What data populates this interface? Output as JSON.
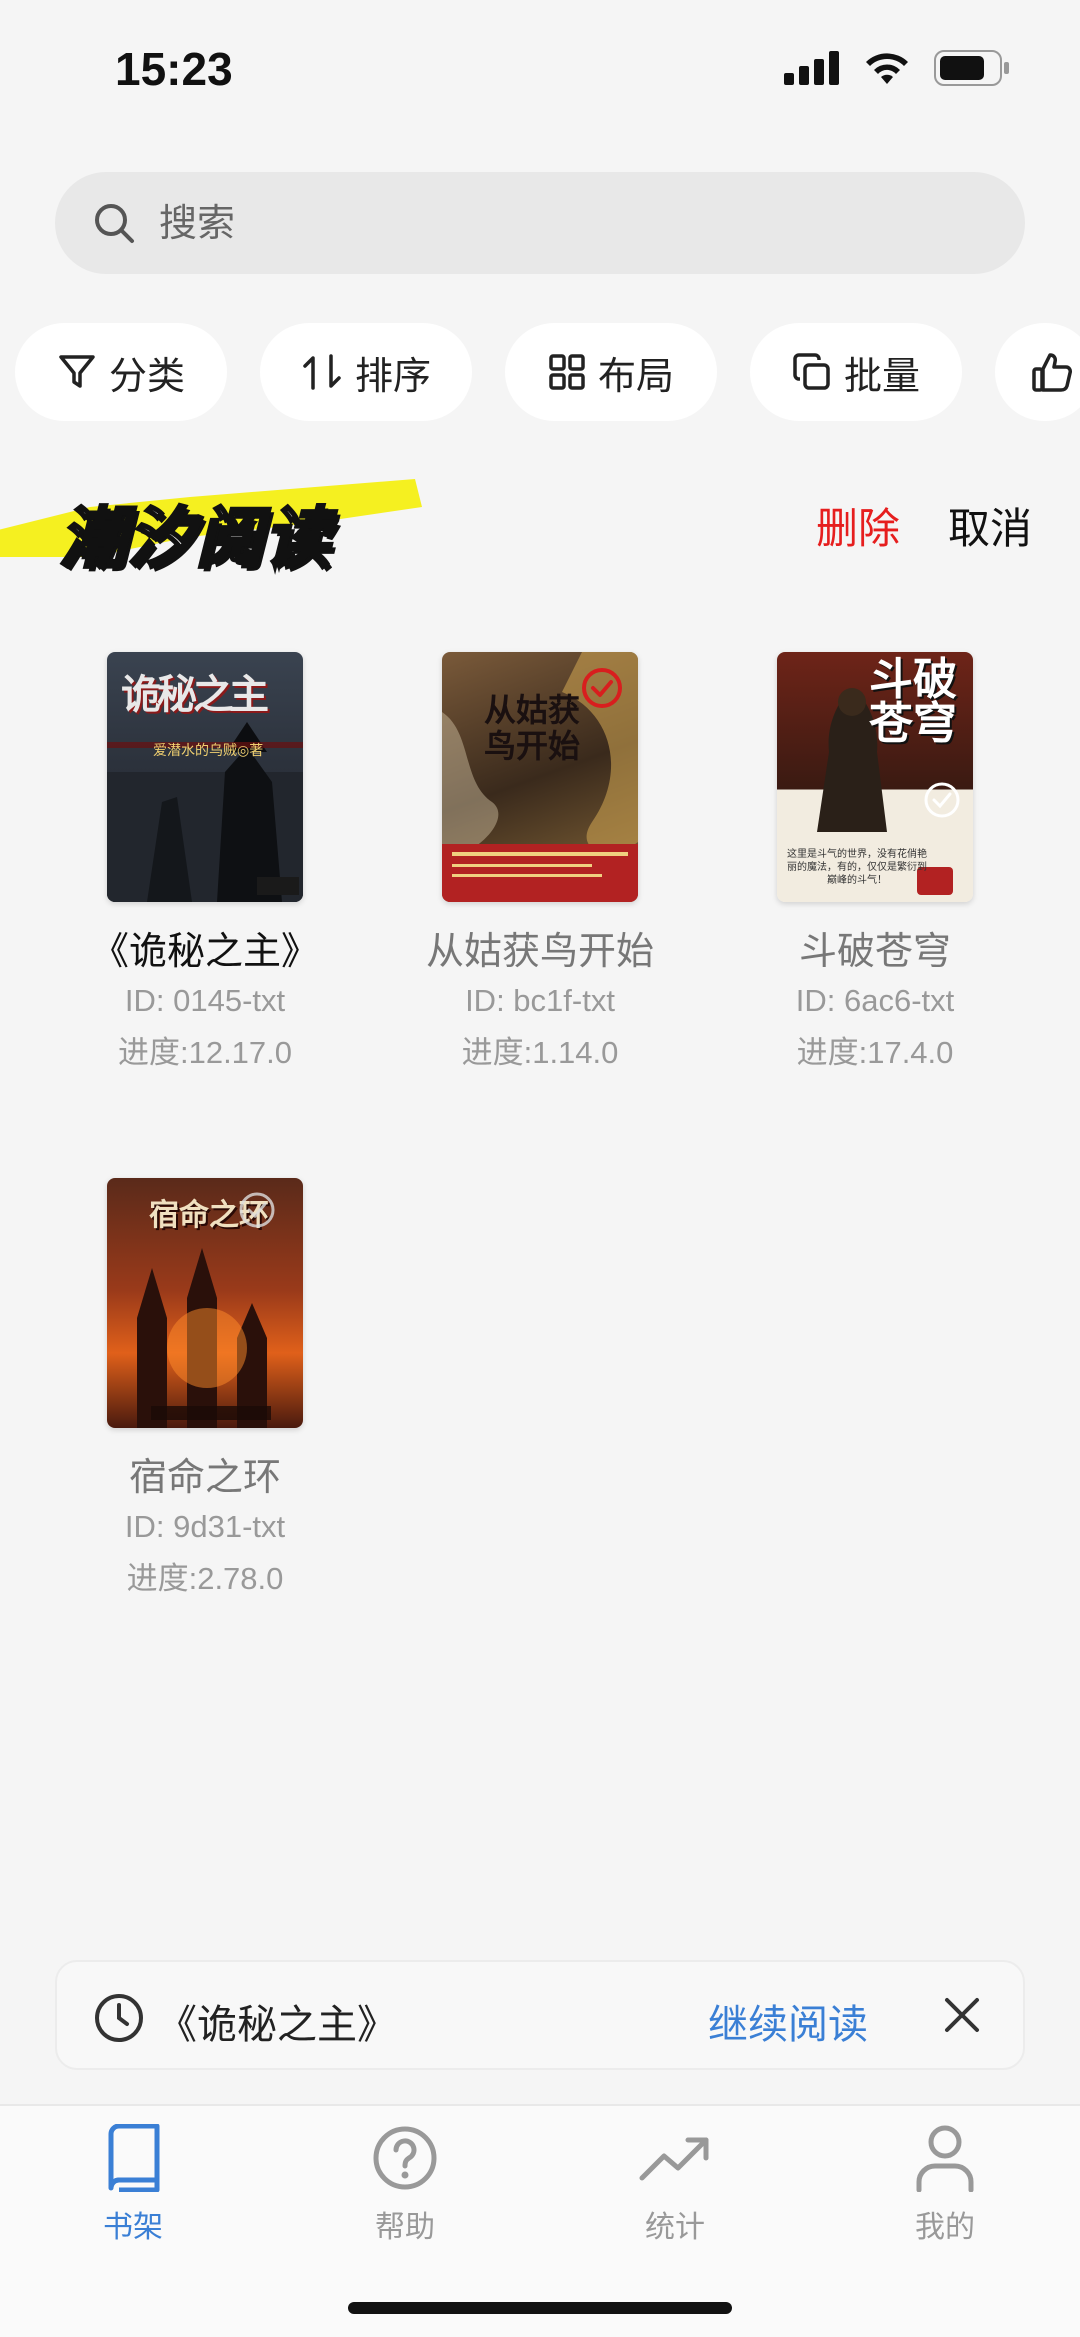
{
  "status": {
    "time": "15:23"
  },
  "search": {
    "placeholder": "搜索"
  },
  "chips": [
    {
      "label": "分类",
      "icon": "filter-icon"
    },
    {
      "label": "排序",
      "icon": "sort-icon"
    },
    {
      "label": "布局",
      "icon": "grid-icon"
    },
    {
      "label": "批量",
      "icon": "copy-icon"
    },
    {
      "label": "",
      "icon": "thumbs-up-icon"
    }
  ],
  "header": {
    "brand": "潮汐阅读",
    "delete_label": "删除",
    "cancel_label": "取消",
    "highlight_color": "#f5f020"
  },
  "books": [
    {
      "title": "《诡秘之主》",
      "id": "ID: 0145-txt",
      "progress": "进度:12.17.0",
      "cover_text": "诡秘之主",
      "cover_sub": "爱潜水的乌贼◎著",
      "selected": false
    },
    {
      "title": "从姑获鸟开始",
      "id": "ID: bc1f-txt",
      "progress": "进度:1.14.0",
      "cover_text": "从姑获鸟开始",
      "selected": true
    },
    {
      "title": "斗破苍穹",
      "id": "ID: 6ac6-txt",
      "progress": "进度:17.4.0",
      "cover_text": "斗破苍穹",
      "cover_sub": "这里是斗气的世界，没有花俏艳丽的魔法，有的，仅仅是繁衍到巅峰的斗气！",
      "selected": true
    },
    {
      "title": "宿命之环",
      "id": "ID: 9d31-txt",
      "progress": "进度:2.78.0",
      "cover_text": "宿命之环",
      "selected": false
    }
  ],
  "recent": {
    "title": "《诡秘之主》",
    "continue_label": "继续阅读"
  },
  "tabs": [
    {
      "label": "书架",
      "icon": "book-icon",
      "active": true
    },
    {
      "label": "帮助",
      "icon": "help-icon",
      "active": false
    },
    {
      "label": "统计",
      "icon": "trend-icon",
      "active": false
    },
    {
      "label": "我的",
      "icon": "user-icon",
      "active": false
    }
  ],
  "colors": {
    "accent": "#3a7fd5",
    "danger": "#e61e1e"
  }
}
